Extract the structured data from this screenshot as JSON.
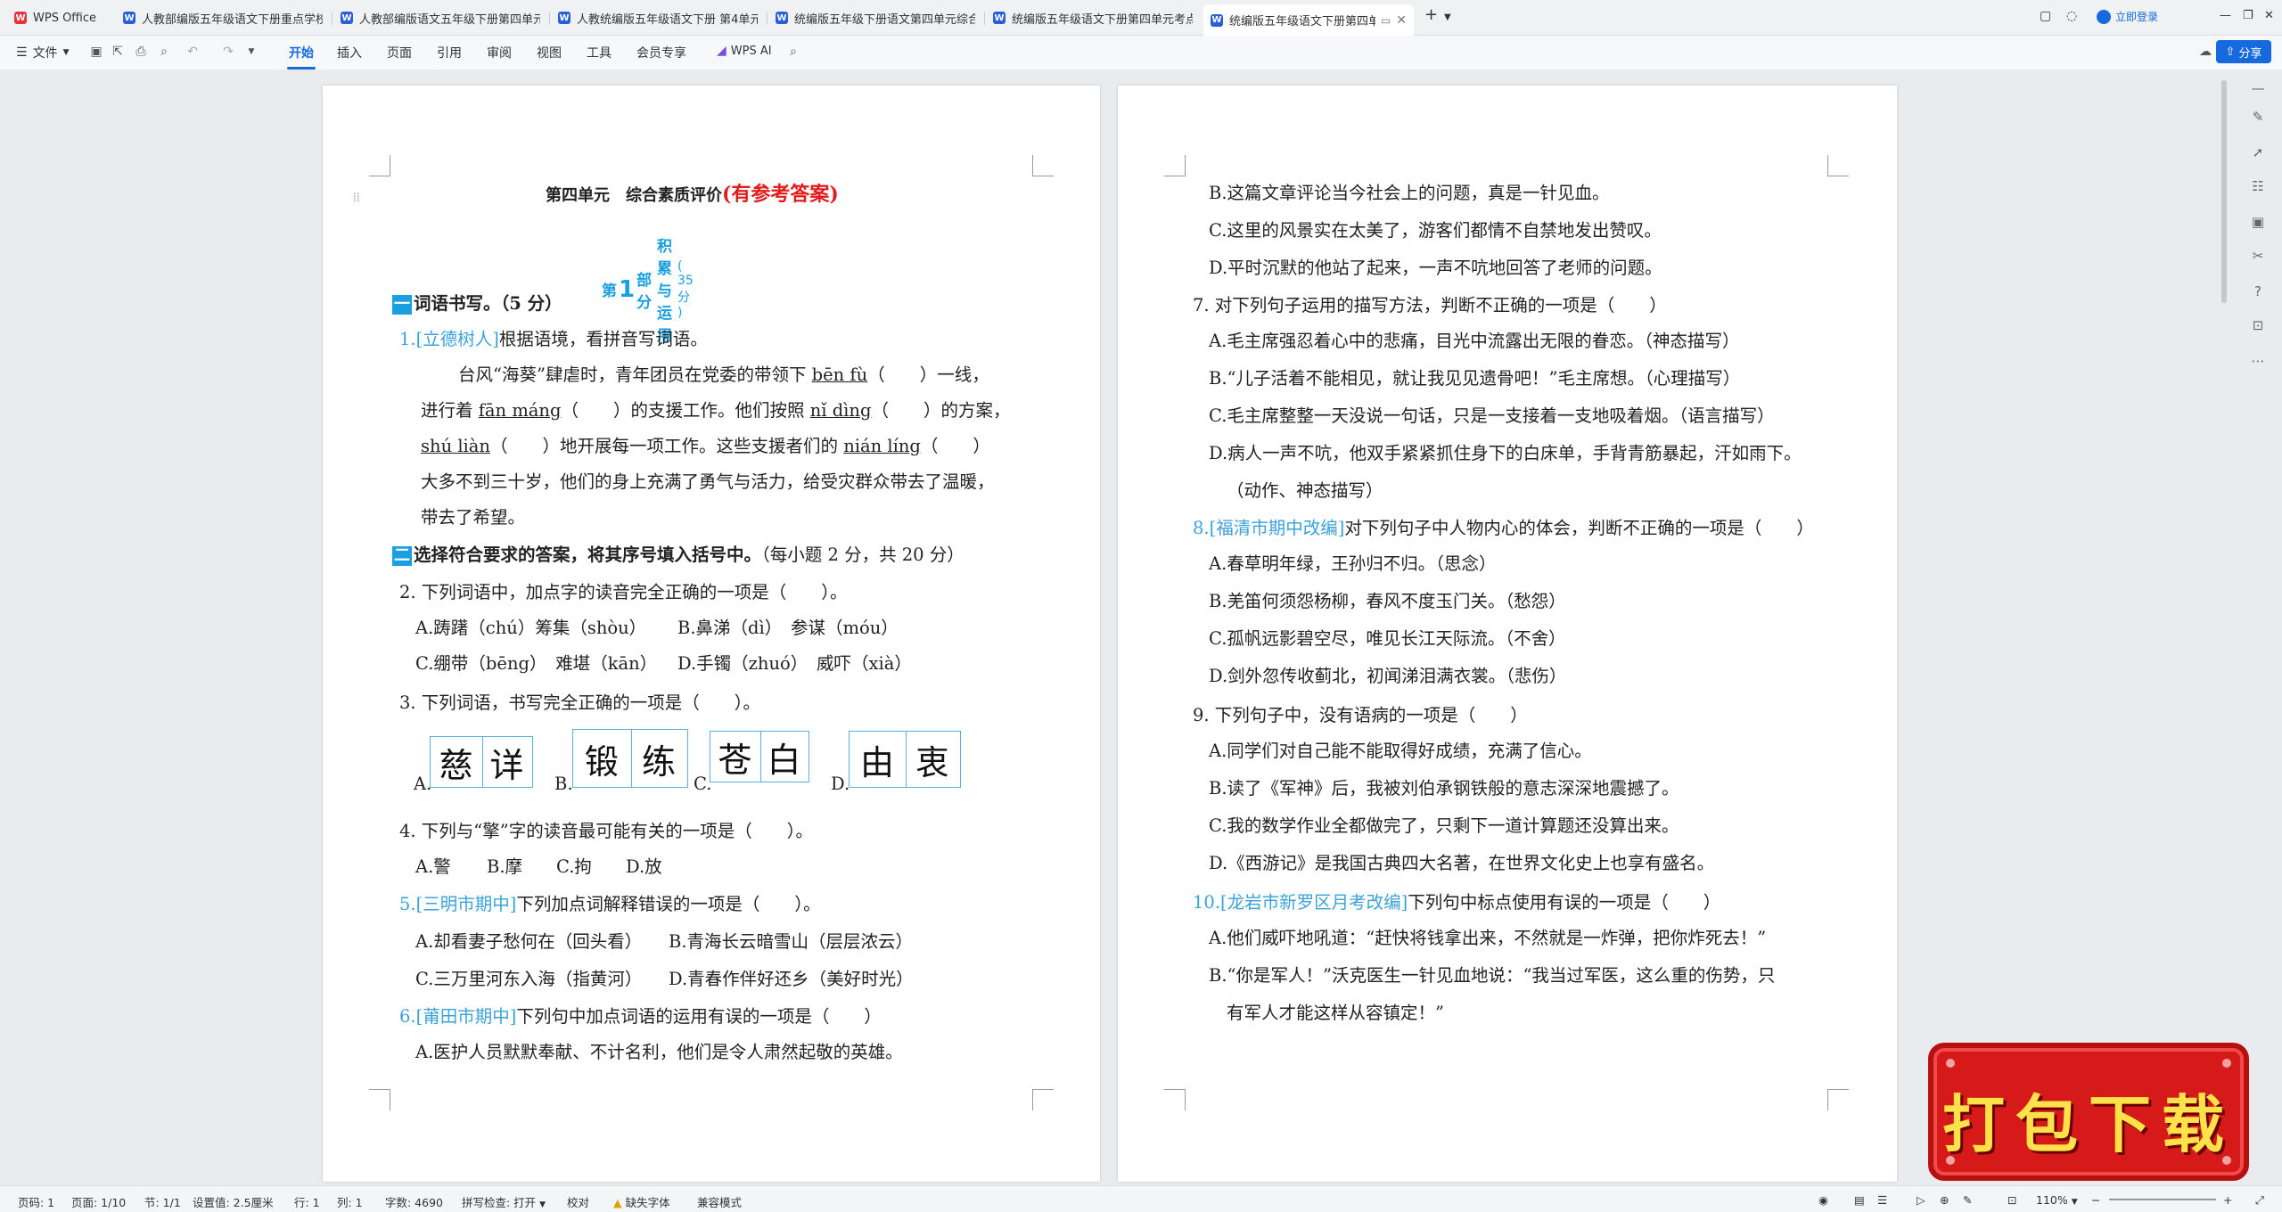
{
  "tabs": [
    {
      "label": "WPS Office",
      "icon": "wps-logo-icon"
    },
    {
      "label": "人教部编版五年级语文下册重点学校别...",
      "icon": "word-doc-icon"
    },
    {
      "label": "人教部编版语文五年级下册第四单元...",
      "icon": "word-doc-icon"
    },
    {
      "label": "人教统编版五年级语文下册 第4单元...",
      "icon": "word-doc-icon"
    },
    {
      "label": "统编版五年级下册语文第四单元综合素...",
      "icon": "word-doc-icon"
    },
    {
      "label": "统编版五年级语文下册第四单元考点...",
      "icon": "word-doc-icon"
    },
    {
      "label": "统编版五年级语文下册第四单元...",
      "icon": "word-doc-icon",
      "active": true
    }
  ],
  "titlebar": {
    "login": "立即登录"
  },
  "toolbar": {
    "file": "文件",
    "menus": [
      "开始",
      "插入",
      "页面",
      "引用",
      "审阅",
      "视图",
      "工具",
      "会员专享"
    ],
    "active": "开始",
    "ai": "WPS AI",
    "share": "分享"
  },
  "doc": {
    "title_black": "第四单元　综合素质评价",
    "title_red": "(有参考答案)",
    "part_label": "第",
    "part_num": "1",
    "part_label2": "部分",
    "part_name": "积累与运用",
    "part_score": "( 35 分 )",
    "s1_num": "一",
    "s1_title": "词语书写。（5 分）",
    "q1_num": "1.",
    "q1_tag": "[立德树人]",
    "q1_text": "根据语境，看拼音写词语。",
    "p1_a": "台风“海葵”肆虐时，青年团员在党委的带领下",
    "p1_py1": "bēn fù",
    "p1_b": "（　　）一线，",
    "p2_a": "进行着",
    "p2_py": "fān máng",
    "p2_b": "（　　）的支援工作。他们按照",
    "p2_py2": "nǐ dìng",
    "p2_c": "（　　）的方案，",
    "p3_py": "shú liàn",
    "p3_a": "（　　）地开展每一项工作。这些支援者们的",
    "p3_py2": "nián líng",
    "p3_b": "（　　）",
    "p4": "大多不到三十岁，他们的身上充满了勇气与活力，给受灾群众带去了温暖，",
    "p5": "带去了希望。",
    "s2_num": "二",
    "s2_title": "选择符合要求的答案，将其序号填入括号中。",
    "s2_score": "（每小题 2 分，共 20 分）",
    "q2": "2. 下列词语中，加点字的读音完全正确的一项是（　　）。",
    "q2a": "A.踌躇（chú）筹集（shòu）",
    "q2b": "B.鼻涕（dì）　参谋（móu）",
    "q2c": "C.绷带（bēng）　难堪（kān）",
    "q2d": "D.手镯（zhuó）　威吓（xià）",
    "q3": "3. 下列词语，书写完全正确的一项是（　　）。",
    "q3_opts": [
      "A.",
      "B.",
      "C.",
      "D."
    ],
    "q3_boxes": [
      [
        "慈",
        "详"
      ],
      [
        "锻",
        "练"
      ],
      [
        "苍",
        "白"
      ],
      [
        "由",
        "衷"
      ]
    ],
    "q4": "4. 下列与“擎”字的读音最可能有关的一项是（　　）。",
    "q4_opts": [
      "A.警",
      "B.摩",
      "C.拘",
      "D.放"
    ],
    "q5_num": "5.",
    "q5_tag": "[三明市期中]",
    "q5_text": "下列加点词解释错误的一项是（　　）。",
    "q5a": "A.却看妻子愁何在（回头看）",
    "q5b": "B.青海长云暗雪山（层层浓云）",
    "q5c": "C.三万里河东入海（指黄河）",
    "q5d": "D.青春作伴好还乡（美好时光）",
    "q6_num": "6.",
    "q6_tag": "[莆田市期中]",
    "q6_text": "下列句中加点词语的运用有误的一项是（　　）",
    "q6a": "A.医护人员默默奉献、不计名利，他们是令人肃然起敬的英雄。",
    "r1": "B.这篇文章评论当今社会上的问题，真是一针见血。",
    "r2": "C.这里的风景实在太美了，游客们都情不自禁地发出赞叹。",
    "r3": "D.平时沉默的他站了起来，一声不吭地回答了老师的问题。",
    "q7": "7. 对下列句子运用的描写方法，判断不正确的一项是（　　）",
    "q7a": "A.毛主席强忍着心中的悲痛，目光中流露出无限的眷恋。（神态描写）",
    "q7b": "B.“儿子活着不能相见，就让我见见遗骨吧！”毛主席想。（心理描写）",
    "q7c": "C.毛主席整整一天没说一句话，只是一支接着一支地吸着烟。（语言描写）",
    "q7d": "D.病人一声不吭，他双手紧紧抓住身下的白床单，手背青筋暴起，汗如雨下。",
    "q7d2": "（动作、神态描写）",
    "q8_num": "8.",
    "q8_tag": "[福清市期中改编]",
    "q8_text": "对下列句子中人物内心的体会，判断不正确的一项是（　　）",
    "q8a": "A.春草明年绿，王孙归不归。（思念）",
    "q8b": "B.羌笛何须怨杨柳，春风不度玉门关。（愁怨）",
    "q8c": "C.孤帆远影碧空尽，唯见长江天际流。（不舍）",
    "q8d": "D.剑外忽传收蓟北，初闻涕泪满衣裳。（悲伤）",
    "q9": "9. 下列句子中，没有语病的一项是（　　）",
    "q9a": "A.同学们对自己能不能取得好成绩，充满了信心。",
    "q9b": "B.读了《军神》后，我被刘伯承钢铁般的意志深深地震撼了。",
    "q9c": "C.我的数学作业全都做完了，只剩下一道计算题还没算出来。",
    "q9d": "D.《西游记》是我国古典四大名著，在世界文化史上也享有盛名。",
    "q10_num": "10.",
    "q10_tag": "[龙岩市新罗区月考改编]",
    "q10_text": "下列句中标点使用有误的一项是（　　）",
    "q10a": "A.他们威吓地吼道：“赶快将钱拿出来，不然就是一炸弹，把你炸死去！”",
    "q10b": "B.“你是军人！”沃克医生一针见血地说：“我当过军医，这么重的伤势，只",
    "q10b2": "有军人才能这样从容镇定！”"
  },
  "status": {
    "page": "页码: 1",
    "pages": "页面: 1/10",
    "section": "节: 1/1",
    "setting": "设置值: 2.5厘米",
    "row": "行: 1",
    "col": "列: 1",
    "words": "字数: 4690",
    "spell": "拼写检查: 打开",
    "proof": "校对",
    "font": "缺失字体",
    "compat": "兼容模式",
    "zoom": "110%"
  },
  "promo": {
    "text": "打包下载"
  }
}
